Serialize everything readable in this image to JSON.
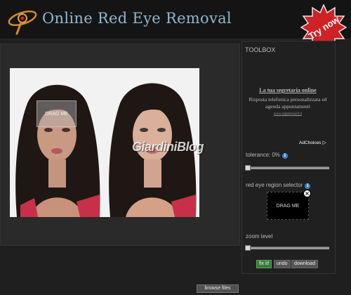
{
  "header": {
    "title": "Online Red Eye Removal",
    "logo_icon": "eye-logo-icon",
    "badge_label": "Try now",
    "badge_color": "#cf2227"
  },
  "workspace": {
    "drag_label": "DRAG ME",
    "watermark": "GiardiniBlog"
  },
  "toolbox": {
    "title": "TOOLBOX",
    "ad": {
      "title": "La tua segretaria online",
      "body": "Risposta telefonica personalizzata ed agenda appuntamenti",
      "url": "www.segreteria24.it",
      "adchoices": "AdChoices",
      "adchoices_icon": "▷"
    },
    "tolerance_label": "tolerance: 0%",
    "selector_label": "red eye region selector",
    "selector_drag_label": "DRAG ME",
    "close_icon": "×",
    "zoom_label": "zoom level",
    "info_icon": "i",
    "buttons": {
      "fix": "fix it!",
      "undo": "undo",
      "download": "download"
    },
    "fix_color": "#3a7d3a"
  },
  "browse_label": "browse files"
}
